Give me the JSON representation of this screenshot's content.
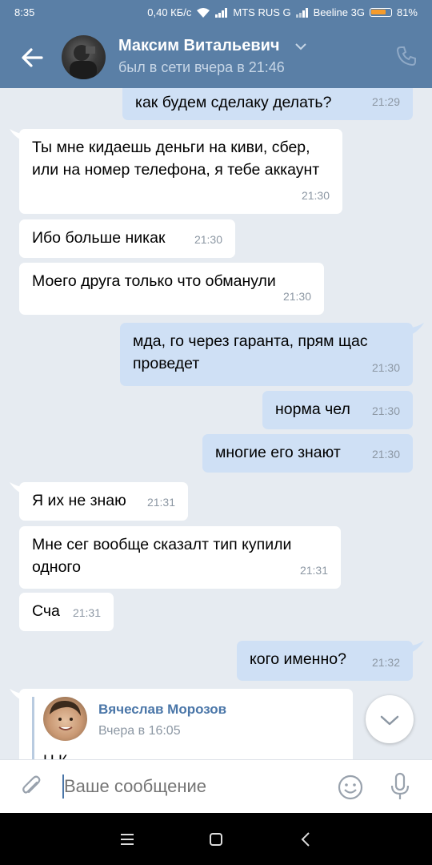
{
  "status": {
    "time": "8:35",
    "speed": "0,40 КБ/с",
    "carrier1": "MTS RUS G",
    "carrier2": "Beeline 3G",
    "battery": "81%",
    "battery_level": 0.81
  },
  "header": {
    "name": "Максим Витальевич",
    "last_seen": "был в сети вчера в 21:46"
  },
  "messages": [
    {
      "dir": "out",
      "text": "как будем сделаку делать?",
      "time": "21:29"
    },
    {
      "dir": "in",
      "text": "Ты мне кидаешь деньги на киви, сбер, или на номер телефона, я тебе аккаунт",
      "time": "21:30"
    },
    {
      "dir": "in",
      "text": "Ибо больше никак",
      "time": "21:30"
    },
    {
      "dir": "in",
      "text": "Моего друга только что обманули",
      "time": "21:30"
    },
    {
      "dir": "out",
      "text": "мда, го через гаранта, прям щас проведет",
      "time": "21:30"
    },
    {
      "dir": "out",
      "text": "норма чел",
      "time": "21:30"
    },
    {
      "dir": "out",
      "text": "многие его знают",
      "time": "21:30"
    },
    {
      "dir": "in",
      "text": "Я их не знаю",
      "time": "21:31"
    },
    {
      "dir": "in",
      "text": "Мне сег вообще сказалт тип купили одного",
      "time": "21:31"
    },
    {
      "dir": "in",
      "text": "Сча",
      "time": "21:31"
    },
    {
      "dir": "out",
      "text": "кого именно?",
      "time": "21:32"
    }
  ],
  "forwarded": {
    "name": "Вячеслав Морозов",
    "time": "Вчера в 16:05",
    "partial_text": "Н                    К"
  },
  "input": {
    "placeholder": "Ваше сообщение"
  },
  "colors": {
    "header_bg": "#5a7fa6",
    "outgoing_bubble": "#cfe0f5",
    "incoming_bubble": "#ffffff",
    "chat_bg": "#e6ebf1",
    "accent": "#4a76a8"
  }
}
